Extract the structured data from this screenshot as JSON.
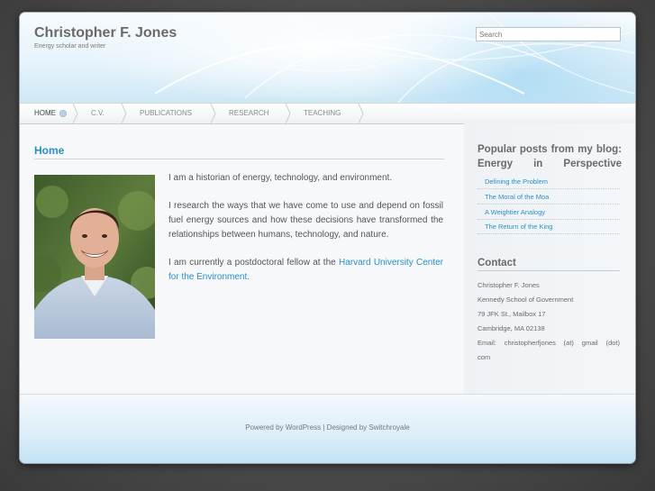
{
  "site": {
    "title": "Christopher F. Jones",
    "tagline": "Energy scholar and writer"
  },
  "search": {
    "placeholder": "Search"
  },
  "nav": {
    "items": [
      {
        "label": "HOME"
      },
      {
        "label": "C.V."
      },
      {
        "label": "PUBLICATIONS"
      },
      {
        "label": "RESEARCH"
      },
      {
        "label": "TEACHING"
      }
    ]
  },
  "main": {
    "title": "Home",
    "para1": "I am a historian of energy, technology, and environment.",
    "para2": "I research the ways that we have come to use and depend on fossil fuel energy sources and how these decisions have transformed the relationships between humans, technology, and nature.",
    "para3_prefix": "I am currently a postdoctoral fellow at the ",
    "para3_link": "Harvard University Center for the Environment",
    "para3_suffix": "."
  },
  "sidebar": {
    "popular_title": "Popular posts from my blog: Energy in Perspective",
    "posts": [
      {
        "label": "Defining the Problem"
      },
      {
        "label": "The Moral of the Moa"
      },
      {
        "label": "A Weightier Analogy"
      },
      {
        "label": "The Return of the King"
      }
    ],
    "contact_title": "Contact",
    "contact": {
      "name": "Christopher F. Jones",
      "org": "Kennedy School of Government",
      "address": "79 JFK St., Mailbox 17",
      "city": "Cambridge, MA 02138",
      "email_line1": "Email: christopherfjones (at) gmail (dot)",
      "email_line2": "com"
    }
  },
  "footer": {
    "text": "Powered by WordPress | Designed by Switchroyale"
  },
  "colors": {
    "accent": "#2a8fc4",
    "title_gray": "#6a6a6a"
  }
}
